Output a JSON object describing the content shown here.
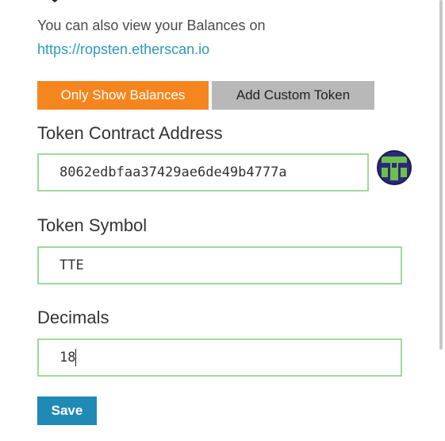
{
  "info": {
    "text": "You can also view your Balances on",
    "link": "https://ropsten.etherscan.io"
  },
  "tabs": {
    "only_show_balances": "Only Show Balances",
    "add_custom_token": "Add Custom Token"
  },
  "form": {
    "contract_label": "Token Contract Address",
    "contract_value": "8062edbfaa37429ae6de49b4777a",
    "symbol_label": "Token Symbol",
    "symbol_value": "TTE",
    "decimals_label": "Decimals",
    "decimals_value": "18",
    "save_label": "Save"
  },
  "colors": {
    "accent_orange": "#f5861f",
    "link_blue": "#2b9ab8",
    "save_blue": "#1f8ab6",
    "input_border_green": "#9ed99e"
  }
}
